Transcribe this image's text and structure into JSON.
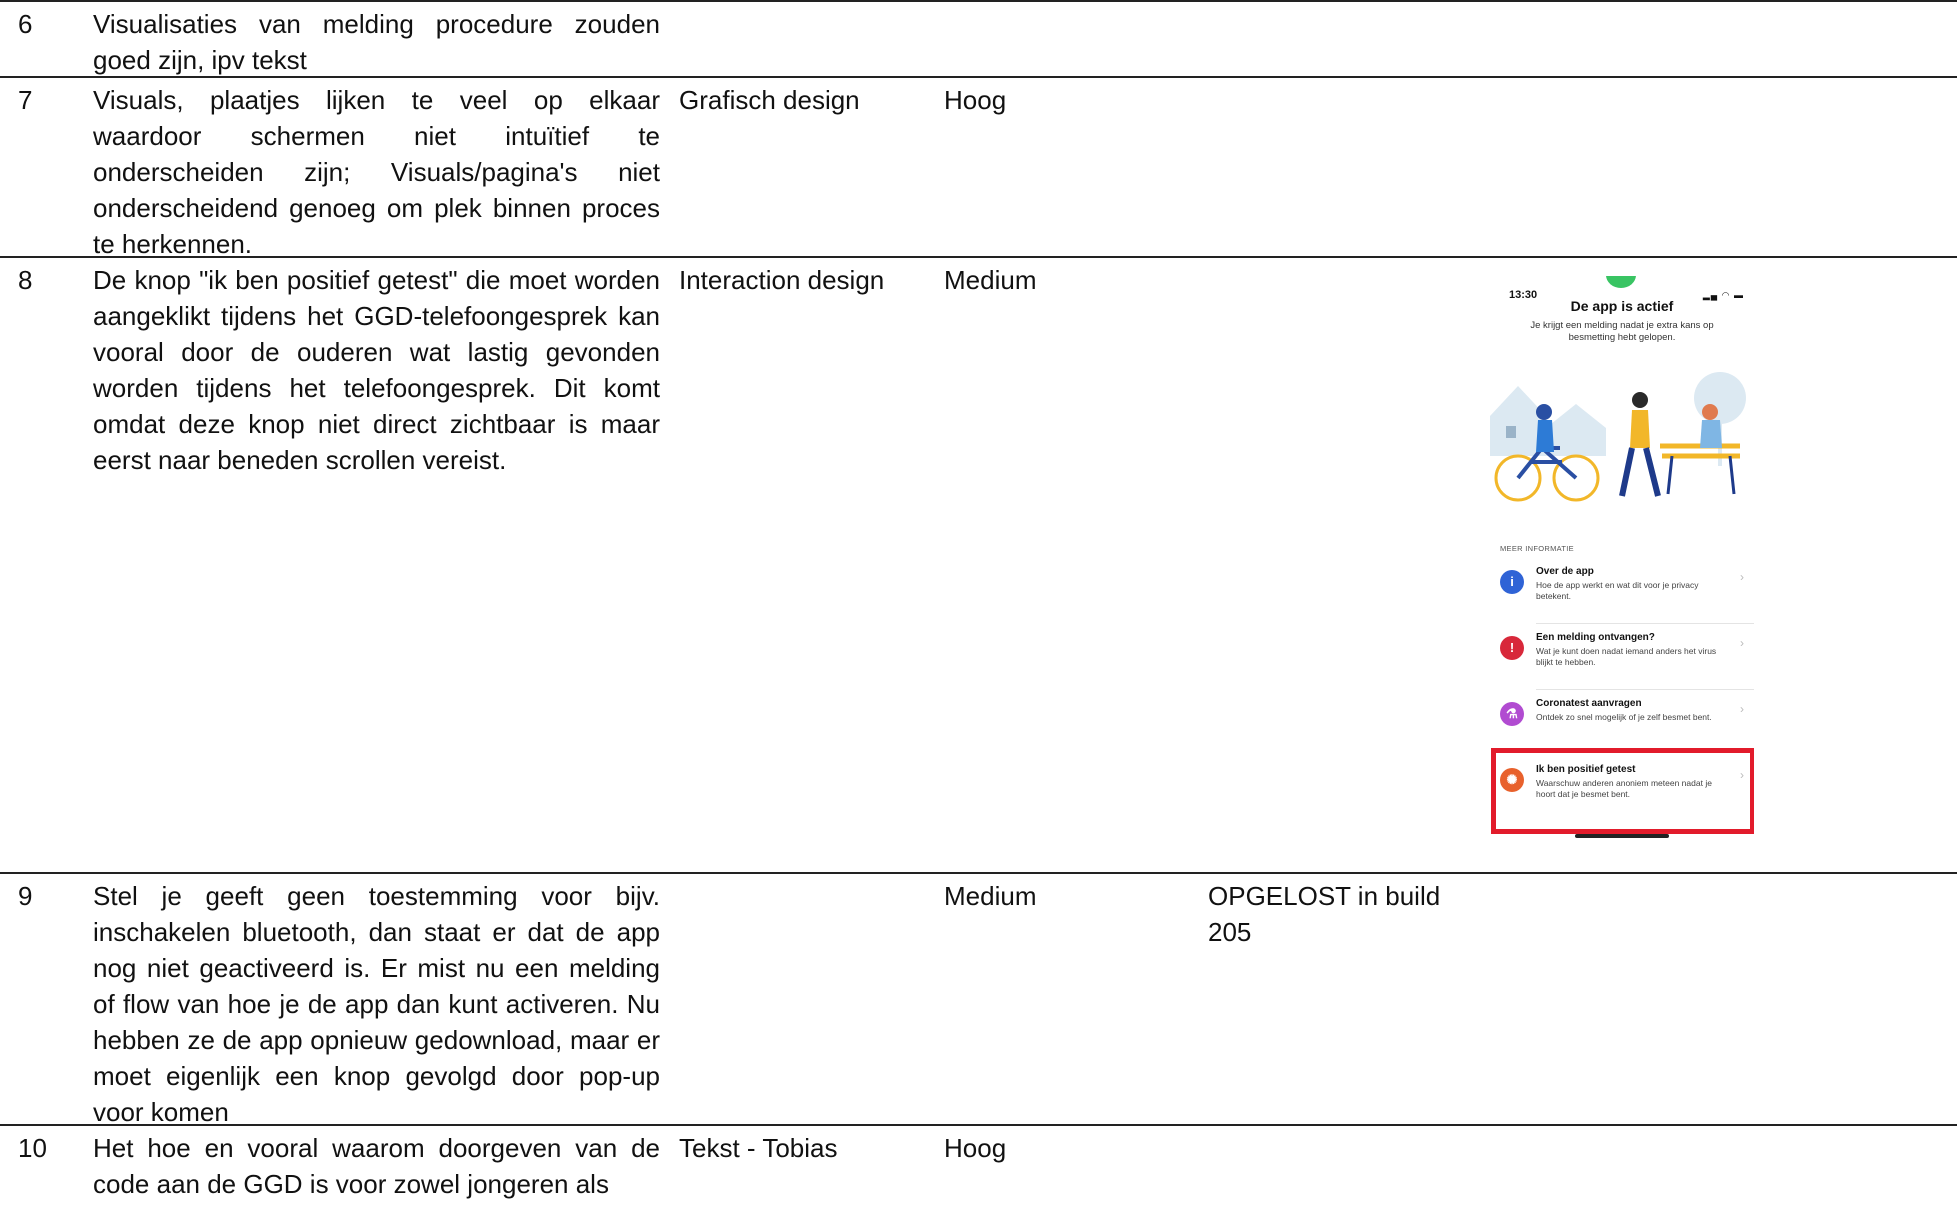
{
  "rows": [
    {
      "num": "6",
      "desc": "Visualisaties van melding procedure zouden goed zijn, ipv tekst",
      "category": "",
      "priority": "",
      "status": ""
    },
    {
      "num": "7",
      "desc": "Visuals, plaatjes lijken te veel op elkaar waardoor schermen niet intuïtief te onderscheiden zijn; Visuals/pagina's niet onderscheidend genoeg om plek binnen proces te herkennen.",
      "category": "Grafisch design",
      "priority": "Hoog",
      "status": ""
    },
    {
      "num": "8",
      "desc": "De knop \"ik ben positief getest\" die moet worden aangeklikt tijdens het GGD-telefoongesprek kan vooral door de ouderen wat lastig gevonden worden tijdens het telefoongesprek. Dit komt omdat deze knop niet direct zichtbaar is maar eerst naar beneden scrollen vereist.",
      "category": "Interaction design",
      "priority": "Medium",
      "status": ""
    },
    {
      "num": "9",
      "desc": "Stel je geeft geen toestemming voor bijv. inschakelen bluetooth, dan staat er dat de app nog niet geactiveerd is. Er mist nu een melding of flow van hoe je de app dan kunt activeren. Nu hebben ze de app opnieuw gedownload, maar er moet eigenlijk een knop gevolgd door pop-up voor komen",
      "category": "",
      "priority": "Medium",
      "status": "OPGELOST in build 205"
    },
    {
      "num": "10",
      "desc": "Het hoe en vooral waarom doorgeven van de code aan de GGD is voor zowel jongeren als",
      "category": "Tekst - Tobias",
      "priority": "Hoog",
      "status": ""
    }
  ],
  "phone": {
    "time": "13:30",
    "status_icons": "▂▄ ◠ ▬",
    "title": "De app is actief",
    "subtitle": "Je krijgt een melding nadat je extra kans op besmetting hebt gelopen.",
    "section_label": "MEER INFORMATIE",
    "items": [
      {
        "title": "Over de app",
        "desc": "Hoe de app werkt en wat dit voor je privacy betekent.",
        "icon": "info-icon",
        "color": "#2f63d6",
        "glyph": "i"
      },
      {
        "title": "Een melding ontvangen?",
        "desc": "Wat je kunt doen nadat iemand anders het virus blijkt te hebben.",
        "icon": "alert-icon",
        "color": "#d8283a",
        "glyph": "!"
      },
      {
        "title": "Coronatest aanvragen",
        "desc": "Ontdek zo snel mogelijk of je zelf besmet bent.",
        "icon": "test-tube-icon",
        "color": "#b14bd1",
        "glyph": "⚗"
      },
      {
        "title": "Ik ben positief getest",
        "desc": "Waarschuw anderen anoniem meteen nadat je hoort dat je besmet bent.",
        "icon": "virus-icon",
        "color": "#e8612c",
        "glyph": "✺"
      }
    ],
    "highlight_color": "#e21b2b"
  }
}
